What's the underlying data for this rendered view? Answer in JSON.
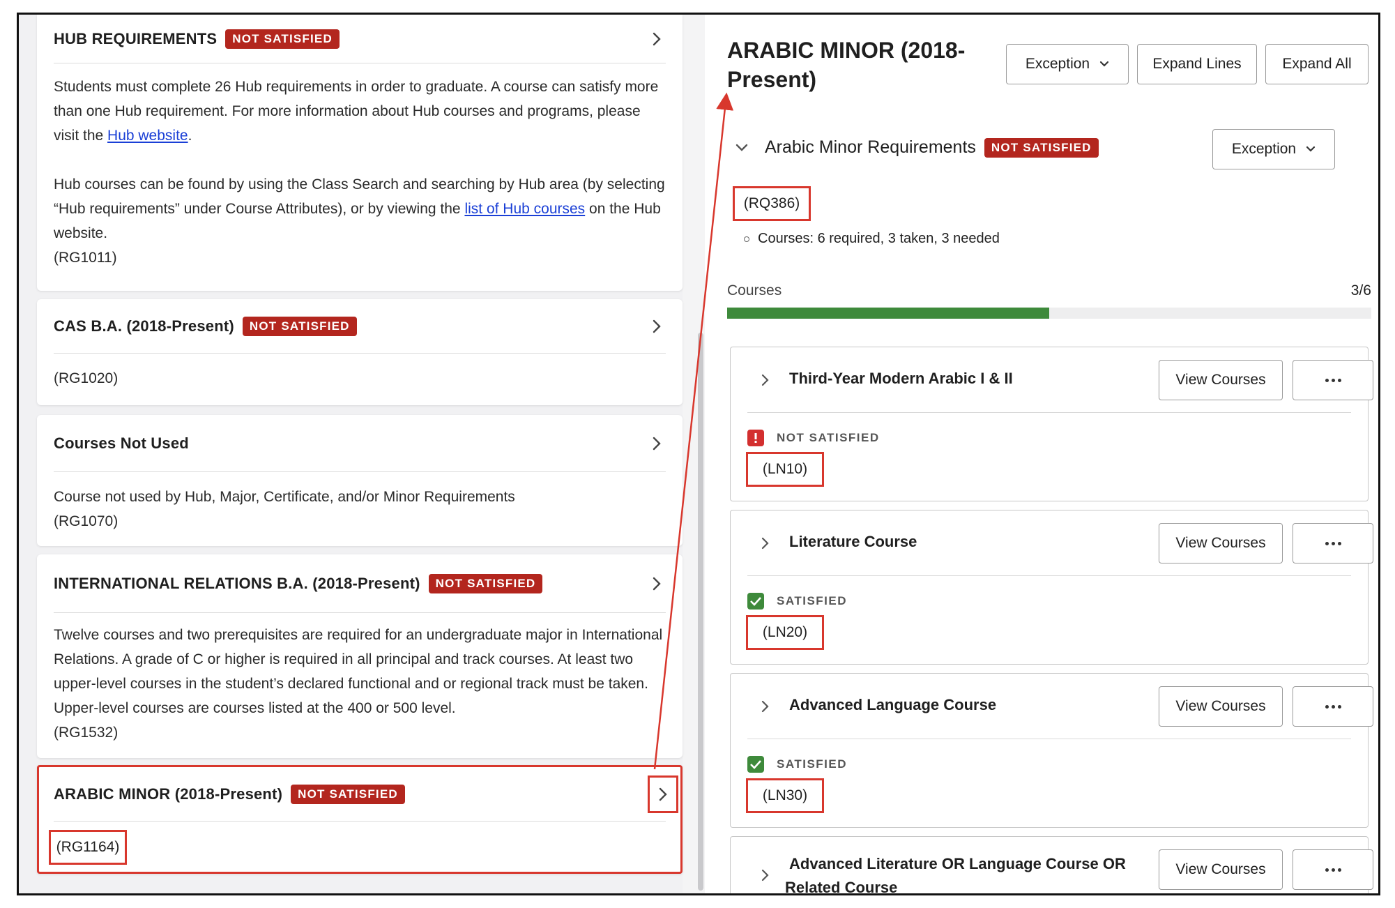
{
  "left": {
    "cards": [
      {
        "title": "HUB REQUIREMENTS",
        "badge": "NOT SATISFIED",
        "p1_a": "Students must complete 26 Hub requirements in order to graduate. A course can satisfy more than one Hub requirement. For more information about Hub courses and programs, please visit the ",
        "p1_link": "Hub website",
        "p1_b": ".",
        "p2_a": "Hub courses can be found by using the Class Search and searching by Hub area (by selecting “Hub requirements” under Course Attributes), or by viewing the ",
        "p2_link": "list of Hub courses",
        "p2_b": " on the Hub website.",
        "code": "(RG1011)"
      },
      {
        "title": "CAS B.A. (2018-Present)",
        "badge": "NOT SATISFIED",
        "code": "(RG1020)"
      },
      {
        "title": "Courses Not Used",
        "text": "Course not used by Hub, Major, Certificate, and/or Minor Requirements",
        "code": "(RG1070)"
      },
      {
        "title": "INTERNATIONAL RELATIONS B.A. (2018-Present)",
        "badge": "NOT SATISFIED",
        "text": "Twelve courses and two prerequisites are required for an undergraduate major in International Relations. A grade of C or higher is required in all principal and track courses. At least two upper-level courses in the student’s declared functional and or regional track must be taken. Upper-level courses are courses listed at the 400 or 500 level.",
        "code": "(RG1532)"
      },
      {
        "title": "ARABIC MINOR (2018-Present)",
        "badge": "NOT SATISFIED",
        "code": "(RG1164)"
      }
    ]
  },
  "right": {
    "title": "ARABIC MINOR (2018-Present)",
    "buttons": {
      "exception": "Exception",
      "expand_lines": "Expand Lines",
      "expand_all": "Expand All"
    },
    "section": {
      "title": "Arabic Minor Requirements",
      "badge": "NOT SATISFIED",
      "exception": "Exception",
      "code": "(RQ386)",
      "courses_line": "Courses: 6 required, 3 taken, 3 needed"
    },
    "progress": {
      "label": "Courses",
      "count": "3/6",
      "fraction": 0.5
    },
    "requirements": [
      {
        "title": "Third-Year Modern Arabic I & II",
        "view": "View Courses",
        "status": "NOT SATISFIED",
        "code": "(LN10)"
      },
      {
        "title": "Literature Course",
        "view": "View Courses",
        "status": "SATISFIED",
        "code": "(LN20)"
      },
      {
        "title": "Advanced Language Course",
        "view": "View Courses",
        "status": "SATISFIED",
        "code": "(LN30)"
      },
      {
        "title_l1": "Advanced Literature OR Language Course OR",
        "title_l2": "Related Course",
        "view": "View Courses"
      }
    ]
  },
  "colors": {
    "badge_red": "#b3261e",
    "highlight_red": "#d8372d",
    "progress_green": "#3e8a3b"
  }
}
